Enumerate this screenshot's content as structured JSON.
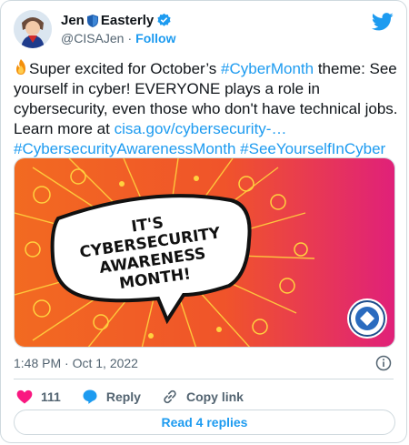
{
  "author": {
    "display_name_part1": "Jen",
    "display_name_part2": "Easterly",
    "handle": "@CISAJen",
    "separator": "·",
    "follow_label": "Follow"
  },
  "tweet": {
    "text_1": "Super excited for October’s ",
    "hashtag_1": "#CyberMonth",
    "text_2": " theme: See yourself in cyber! EVERYONE plays a role in cybersecurity, even those who don't have technical jobs. Learn more at ",
    "link": "cisa.gov/cybersecurity-…",
    "hashtag_2": "#CybersecurityAwarenessMonth",
    "hashtag_3": "#SeeYourselfInCyber"
  },
  "media": {
    "banner_line_1": "IT'S",
    "banner_line_2": "CYBERSECURITY",
    "banner_line_3": "AWARENESS",
    "banner_line_4": "MONTH!"
  },
  "meta": {
    "timestamp": "1:48 PM · Oct 1, 2022"
  },
  "actions": {
    "like_count": "111",
    "reply_label": "Reply",
    "copy_link_label": "Copy link"
  },
  "read_replies_label": "Read 4 replies",
  "colors": {
    "accent": "#1d9bf0",
    "like": "#f91880",
    "media_orange": "#f26a21",
    "media_magenta": "#e0207a"
  },
  "icons": [
    "avatar",
    "shield-icon",
    "verified-badge-icon",
    "twitter-bird-icon",
    "fire-emoji-icon",
    "info-icon",
    "heart-icon",
    "reply-bubble-icon",
    "link-icon",
    "cisa-seal-icon"
  ]
}
